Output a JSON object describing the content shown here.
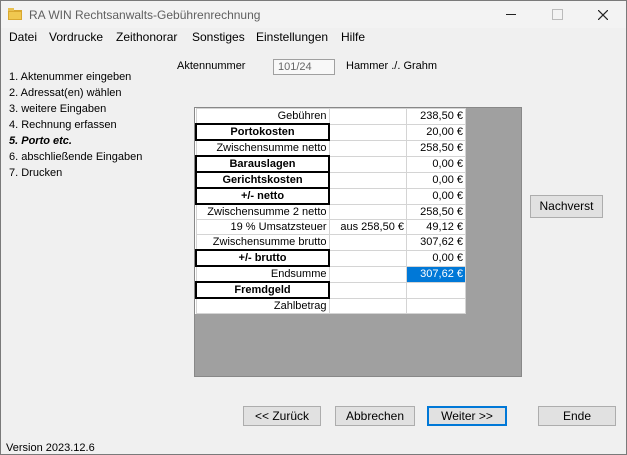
{
  "window": {
    "title": "RA WIN Rechtsanwalts-Gebührenrechnung"
  },
  "menu": [
    "Datei",
    "Vordrucke",
    "Zeithonorar",
    "Sonstiges",
    "Einstellungen",
    "Hilfe"
  ],
  "steps": [
    "1. Aktenummer eingeben",
    "2. Adressat(en) wählen",
    "3. weitere Eingaben",
    "4. Rechnung erfassen",
    "5. Porto etc.",
    "6. abschließende Eingaben",
    "7. Drucken"
  ],
  "akte": {
    "label": "Aktennummer",
    "value": "101/24",
    "name": "Hammer ./. Grahm"
  },
  "rows": [
    {
      "label": "Gebühren",
      "mid": "",
      "value": "238,50 €"
    },
    {
      "label": "Portokosten",
      "mid": "",
      "value": "20,00 €"
    },
    {
      "label": "Zwischensumme netto",
      "mid": "",
      "value": "258,50 €"
    },
    {
      "label": "Barauslagen",
      "mid": "",
      "value": "0,00 €"
    },
    {
      "label": "Gerichtskosten",
      "mid": "",
      "value": "0,00 €"
    },
    {
      "label": "+/- netto",
      "mid": "",
      "value": "0,00 €"
    },
    {
      "label": "Zwischensumme 2 netto",
      "mid": "",
      "value": "258,50 €"
    },
    {
      "label": "19 % Umsatzsteuer",
      "mid": "aus 258,50 €",
      "value": "49,12 €"
    },
    {
      "label": "Zwischensumme brutto",
      "mid": "",
      "value": "307,62 €"
    },
    {
      "label": "+/- brutto",
      "mid": "",
      "value": "0,00 €"
    },
    {
      "label": "Endsumme",
      "mid": "",
      "value": "307,62 €"
    },
    {
      "label": "Fremdgeld",
      "mid": "",
      "value": ""
    },
    {
      "label": "Zahlbetrag",
      "mid": "",
      "value": ""
    }
  ],
  "buttons": {
    "nachverst": "Nachverst",
    "zurueck": "<< Zurück",
    "abbrechen": "Abbrechen",
    "weiter": "Weiter >>",
    "ende": "Ende"
  },
  "version": "Version 2023.12.6",
  "colors": {
    "selection": "#0078d7",
    "grid_bg": "#a0a0a0"
  }
}
